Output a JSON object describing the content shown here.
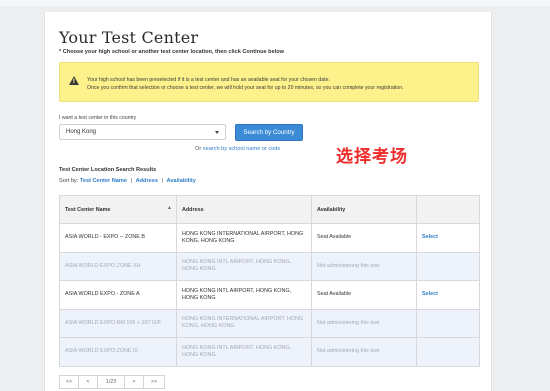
{
  "page": {
    "title": "Your Test Center",
    "instruction": "* Choose your high school or another test center location, then click Continue below"
  },
  "alert": {
    "icon": "warning-icon",
    "line1": "Your high school has been preselected if it is a test center and has an available seat for your chosen date.",
    "line2": "Once you confirm that selection or choose a test center, we will hold your seat for up to 20 minutes, so you can complete your registration."
  },
  "country": {
    "label": "I want a test center in this country",
    "selected": "Hong Kong",
    "search_button": "Search by Country",
    "or_prefix": "Or",
    "or_link": "search by school name or code"
  },
  "overlay_text": "选择考场",
  "results": {
    "title": "Test Center Location Search Results",
    "sort_label": "Sort by:",
    "sort_options": [
      "Test Center Name",
      "Address",
      "Availability"
    ],
    "sort_sep": "|",
    "columns": [
      "Test Center Name",
      "Address",
      "Availability",
      ""
    ],
    "sort_indicator": "▲",
    "rows": [
      {
        "name": "ASIA WORLD - EXPO -- ZONE B",
        "address": "HONG KONG INTERNATIONAL AIRPORT, HONG KONG, HONG KONG",
        "availability": "Seat Available",
        "action": "Select"
      },
      {
        "name": "ASIA WORLD EXPO ZONE XH",
        "address": "HONG KONG INTL AIRPORT, HONG KONG, HONG KONG",
        "availability": "Not administering this test",
        "action": ""
      },
      {
        "name": "ASIA WORLD EXPO - ZONE A",
        "address": "HONG KONG INTL AIRPORT, HONG KONG, HONG KONG",
        "availability": "Seat Available",
        "action": "Select"
      },
      {
        "name": "ASIA WORLD EXPO RM 106 + 107 G/F",
        "address": "HONG KONG INTERNATIONAL AIRPORT, HONG KONG, HONG KONG",
        "availability": "Not administering this test",
        "action": ""
      },
      {
        "name": "ASIA WORLD EXPO ZONE I0",
        "address": "HONG KONG INTL AIRPORT, HONG KONG, HONG KONG",
        "availability": "Not administering this test",
        "action": ""
      }
    ]
  },
  "pagination": {
    "first": "<<",
    "prev": "<",
    "page": "1/23",
    "next": ">",
    "last": ">>"
  },
  "colors": {
    "accent": "#3a8ad6",
    "link": "#2f7dc8",
    "alert_bg": "#fcf18b",
    "overlay_red": "#f02b2b",
    "unavailable_row": "#eef2fa"
  }
}
